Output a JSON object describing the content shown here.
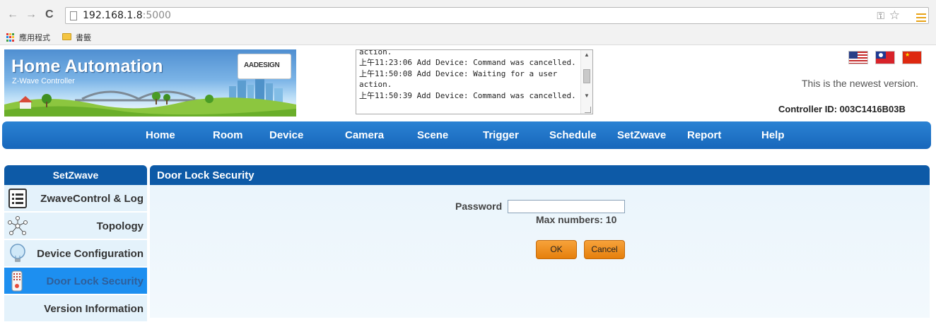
{
  "browser": {
    "url_host": "192.168.1.8",
    "url_port": ":5000",
    "bookmarks": [
      {
        "label": "應用程式",
        "icon": "apps-grid-icon"
      },
      {
        "label": "書籤",
        "icon": "folder-icon"
      }
    ]
  },
  "header": {
    "title": "Home Automation",
    "subtitle": "Z-Wave Controller",
    "logo_text": "AADESIGN",
    "version_status": "This is the newest version.",
    "controller_id": "Controller ID: 003C1416B03B",
    "log_text": "action.\n上午11:23:06 Add Device: Command was cancelled.\n上午11:50:08 Add Device: Waiting for a user action.\n上午11:50:39 Add Device: Command was cancelled."
  },
  "nav": {
    "items": [
      "Home",
      "Room",
      "Device",
      "Camera",
      "Scene",
      "Trigger",
      "Schedule",
      "SetZwave",
      "Report",
      "Help"
    ]
  },
  "sidebar": {
    "title": "SetZwave",
    "items": [
      {
        "label": "ZwaveControl & Log",
        "icon": "list-icon",
        "active": false
      },
      {
        "label": "Topology",
        "icon": "network-icon",
        "active": false
      },
      {
        "label": "Device Configuration",
        "icon": "lightbulb-icon",
        "active": false
      },
      {
        "label": "Door Lock Security",
        "icon": "keypad-lock-icon",
        "active": true
      },
      {
        "label": "Version Information",
        "icon": "",
        "active": false
      }
    ]
  },
  "main": {
    "title": "Door Lock Security",
    "password_label": "Password",
    "password_value": "",
    "hint": "Max numbers: 10",
    "ok_label": "OK",
    "cancel_label": "Cancel"
  },
  "colors": {
    "nav_blue": "#1a6fc2",
    "header_blue": "#0d5aa7",
    "active_blue": "#1d8ff0",
    "button_orange": "#f18f1e"
  }
}
